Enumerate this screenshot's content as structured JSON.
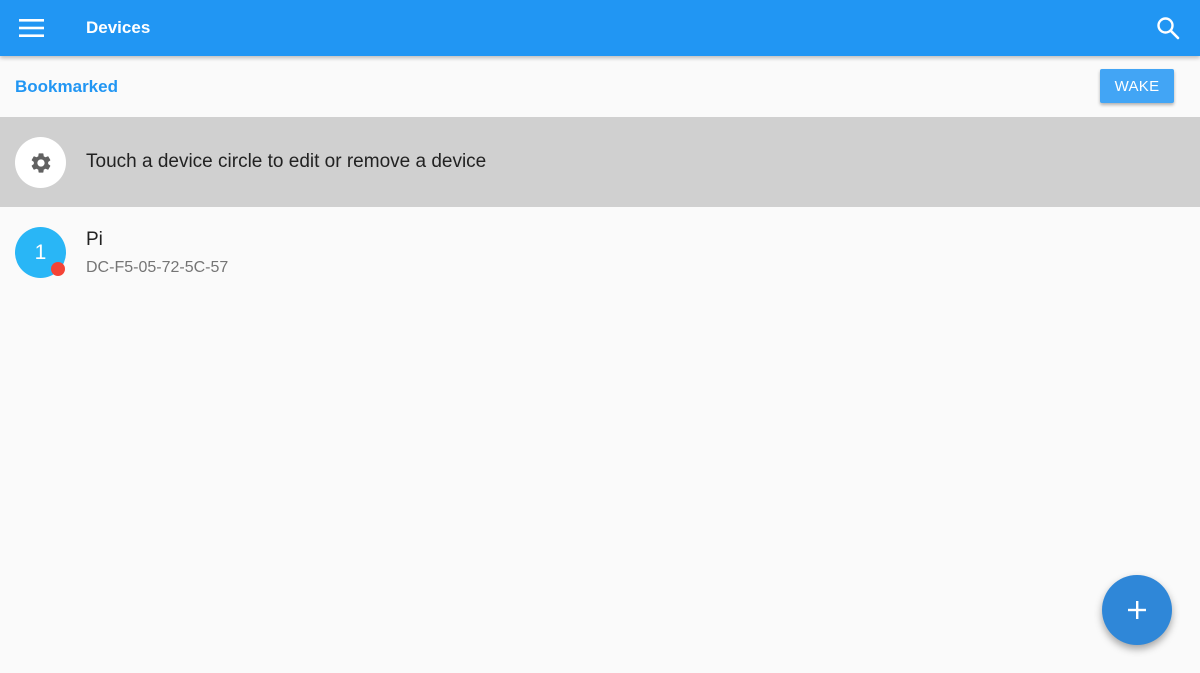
{
  "appbar": {
    "title": "Devices",
    "menu_icon": "hamburger-menu-icon",
    "search_icon": "search-icon",
    "color": "#2196f3"
  },
  "section": {
    "label": "Bookmarked",
    "wake_label": "WAKE"
  },
  "hint": {
    "icon": "gear-icon",
    "text": "Touch a device circle to edit or remove a device"
  },
  "devices": [
    {
      "number": "1",
      "name": "Pi",
      "mac": "DC-F5-05-72-5C-57",
      "status": "offline",
      "status_color": "#f44336",
      "avatar_color": "#29b6f6"
    }
  ],
  "fab": {
    "icon": "plus-icon",
    "color": "#2f87d8"
  }
}
